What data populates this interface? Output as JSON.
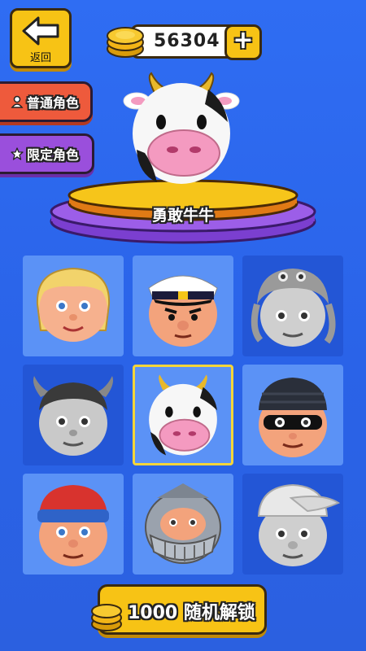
{
  "header": {
    "back_label": "返回",
    "coins": "56304",
    "plus_label": "+"
  },
  "tabs": [
    {
      "label": "普通角色",
      "icon": "person-icon",
      "color": "#ee5a3c"
    },
    {
      "label": "限定角色",
      "icon": "star-icon",
      "color": "#9a4fdc"
    }
  ],
  "hero": {
    "name": "勇敢牛牛"
  },
  "characters": [
    {
      "icon": "blonde-girl-icon",
      "locked": false
    },
    {
      "icon": "captain-icon",
      "locked": false
    },
    {
      "icon": "octopus-hat-icon",
      "locked": true
    },
    {
      "icon": "viking-icon",
      "locked": true
    },
    {
      "icon": "cow-icon",
      "locked": false,
      "selected": true
    },
    {
      "icon": "robber-icon",
      "locked": false
    },
    {
      "icon": "red-beanie-icon",
      "locked": false
    },
    {
      "icon": "knight-helmet-icon",
      "locked": false
    },
    {
      "icon": "cap-boy-icon",
      "locked": true
    }
  ],
  "unlock_button": {
    "cost": "1000",
    "label": "随机解锁"
  },
  "colors": {
    "background": "#2f6df3",
    "accent_yellow": "#f7c315",
    "selected_border": "#f5d53a"
  }
}
